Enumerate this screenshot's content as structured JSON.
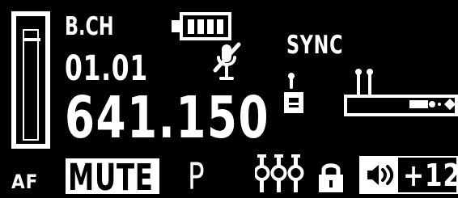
{
  "display": {
    "mode_label": "B.CH",
    "group_channel": "01.01",
    "frequency": "641.150",
    "sync_label": "SYNC",
    "af_label": "AF",
    "mute_label": "MUTE",
    "preset_label": "P",
    "volume_label": "+12",
    "battery_level": 1.0,
    "af_level": 0.88
  },
  "icons": {
    "battery": "battery-icon",
    "mute_mic": "mic-muted-icon",
    "bodypack": "bodypack-transmitter-icon",
    "receiver": "receiver-icon",
    "eq": "equalizer-icon",
    "lock": "lock-icon",
    "speaker": "speaker-icon"
  },
  "colors": {
    "background": "#000000",
    "foreground": "#ffffff"
  }
}
